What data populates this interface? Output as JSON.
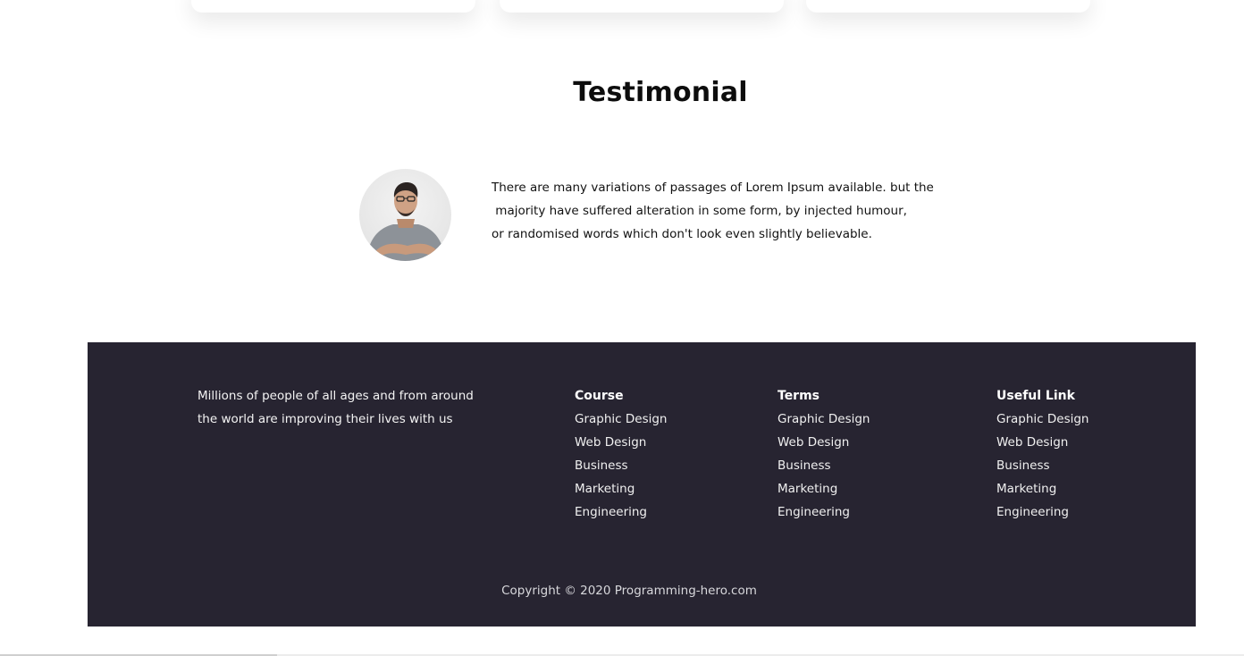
{
  "testimonial": {
    "title": "Testimonial",
    "quote_lines": [
      "There are many variations of passages of Lorem Ipsum available. but the",
      " majority have suffered alteration in some form, by injected humour,",
      "or randomised words which don't look even slightly believable."
    ]
  },
  "footer": {
    "about_lines": [
      "Millions of people of all ages and from around",
      "the world are improving their lives with us"
    ],
    "columns": [
      {
        "heading": "Course",
        "links": [
          "Graphic Design",
          "Web Design",
          "Business",
          "Marketing",
          "Engineering"
        ]
      },
      {
        "heading": "Terms",
        "links": [
          "Graphic Design",
          "Web Design",
          "Business",
          "Marketing",
          "Engineering"
        ]
      },
      {
        "heading": "Useful Link",
        "links": [
          "Graphic Design",
          "Web Design",
          "Business",
          "Marketing",
          "Engineering"
        ]
      }
    ],
    "copyright": "Copyright © 2020 Programming-hero.com"
  },
  "colors": {
    "footer_background": "#272431",
    "heading_text": "#0d0d0d"
  }
}
